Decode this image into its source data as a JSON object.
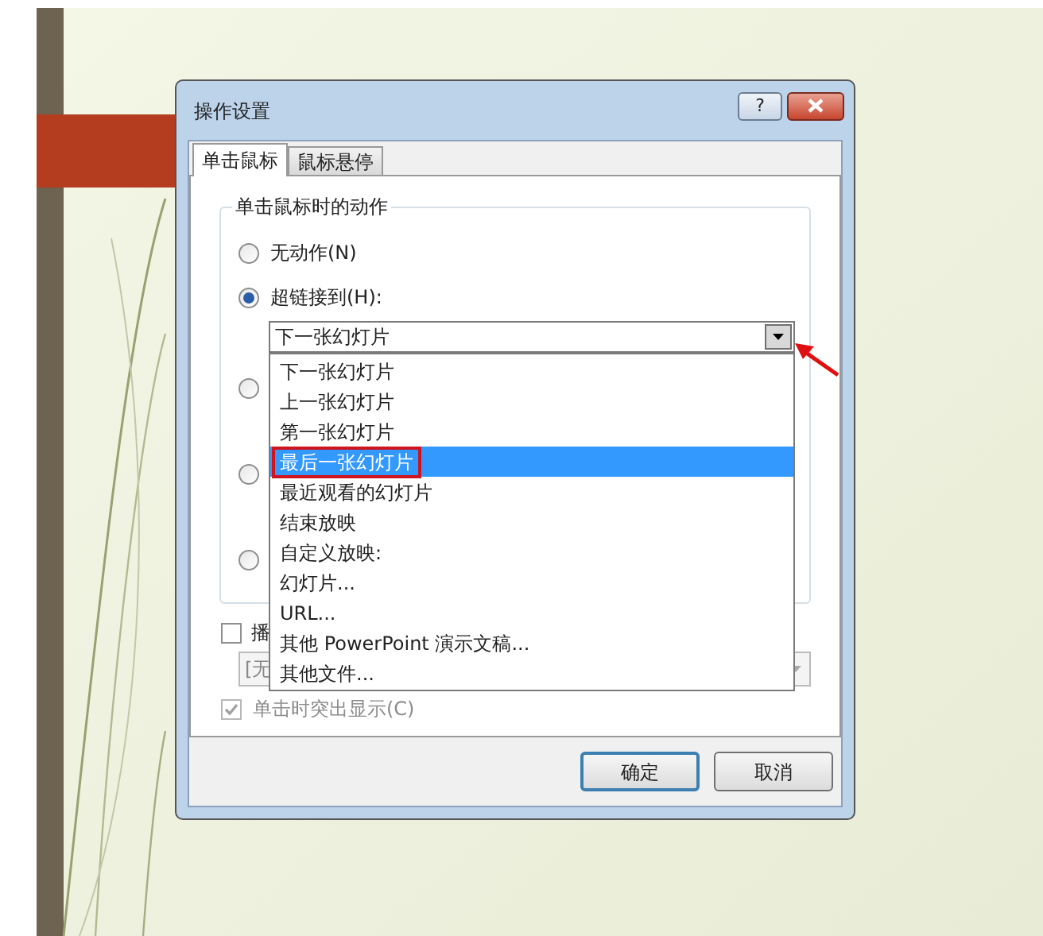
{
  "dialog": {
    "title": "操作设置",
    "help_button": "?",
    "tabs": [
      {
        "label": "单击鼠标",
        "selected": true
      },
      {
        "label": "鼠标悬停",
        "selected": false
      }
    ],
    "group": {
      "title": "单击鼠标时的动作",
      "radios": [
        {
          "label": "无动作(N)",
          "selected": false
        },
        {
          "label": "超链接到(H):",
          "selected": true
        },
        {
          "selected": false
        },
        {
          "selected": false
        },
        {
          "selected": false
        }
      ],
      "hyperlink_combo": {
        "value": "下一张幻灯片",
        "expanded": true,
        "options": [
          {
            "label": "下一张幻灯片",
            "highlighted": false
          },
          {
            "label": "上一张幻灯片",
            "highlighted": false
          },
          {
            "label": "第一张幻灯片",
            "highlighted": false
          },
          {
            "label": "最后一张幻灯片",
            "highlighted": true
          },
          {
            "label": "最近观看的幻灯片",
            "highlighted": false
          },
          {
            "label": "结束放映",
            "highlighted": false
          },
          {
            "label": "自定义放映:",
            "highlighted": false
          },
          {
            "label": "幻灯片...",
            "highlighted": false
          },
          {
            "label": "URL...",
            "highlighted": false
          },
          {
            "label": "其他 PowerPoint 演示文稿...",
            "highlighted": false
          },
          {
            "label": "其他文件...",
            "highlighted": false
          }
        ]
      }
    },
    "play_sound": {
      "label": "播",
      "checked": false
    },
    "sound_combo": {
      "value": "[无"
    },
    "highlight": {
      "label": "单击时突出显示(C)",
      "checked": true,
      "disabled": true
    },
    "buttons": [
      {
        "label": "确定",
        "default": true
      },
      {
        "label": "取消",
        "default": false
      }
    ]
  }
}
